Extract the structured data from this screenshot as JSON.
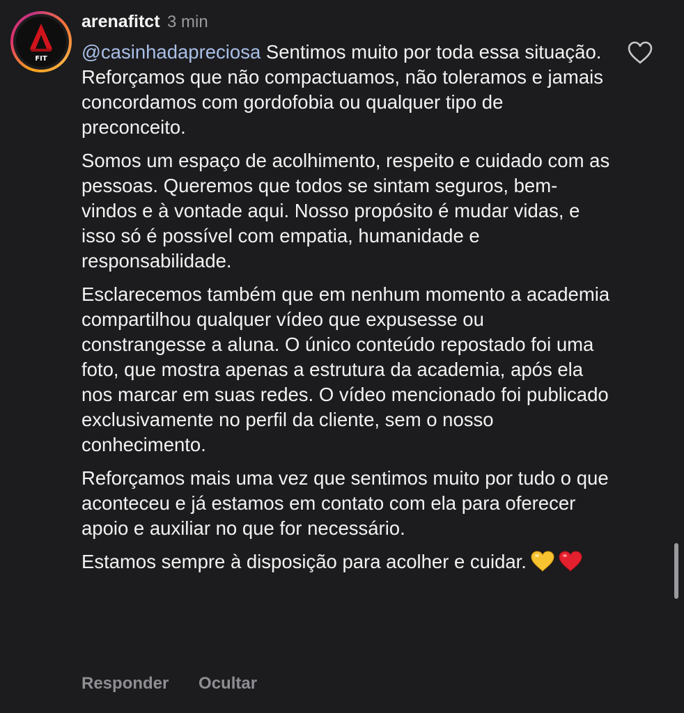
{
  "comment": {
    "username": "arenafitct",
    "time": "3 min",
    "avatar_label": "FIT",
    "mention": "@casinhadapreciosa",
    "paragraph1_rest": " Sentimos muito por toda essa situação. Reforçamos que não compactuamos, não toleramos e jamais concordamos com gordofobia ou qualquer tipo de preconceito.",
    "paragraph2": "Somos um espaço de acolhimento, respeito e cuidado com as pessoas. Queremos que todos se sintam seguros, bem-vindos e à vontade aqui. Nosso propósito é mudar vidas, e isso só é possível com empatia, humanidade e responsabilidade.",
    "paragraph3": "Esclarecemos também que em nenhum momento a academia compartilhou qualquer vídeo que expusesse ou constrangesse a aluna. O único conteúdo repostado foi uma foto, que mostra apenas a estrutura da academia, após ela nos marcar em suas redes. O vídeo mencionado foi publicado exclusivamente no perfil da cliente, sem o nosso conhecimento.",
    "paragraph4": "Reforçamos mais uma vez que sentimos muito por tudo o que aconteceu e já estamos em contato com ela para oferecer apoio e auxiliar no que for necessário.",
    "paragraph5": "Estamos sempre à disposição para acolher e cuidar.",
    "emojis": [
      "yellow-heart-icon",
      "red-heart-icon"
    ]
  },
  "actions": {
    "reply_label": "Responder",
    "hide_label": "Ocultar"
  },
  "colors": {
    "background": "#1c1c1e",
    "text": "#f2f2f2",
    "mention": "#a9bfe8",
    "muted": "#8e8e93",
    "brand_red": "#d0141c"
  }
}
